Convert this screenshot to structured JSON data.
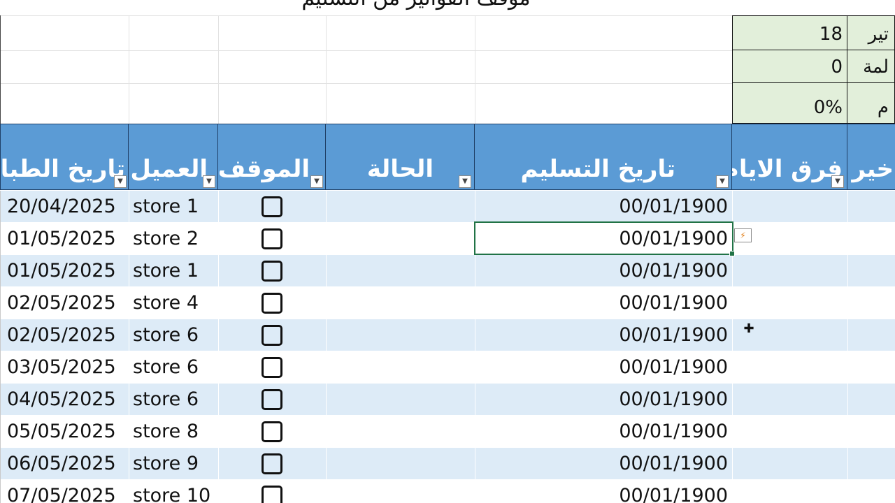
{
  "title": "موقف الفواتير من التسليم",
  "summary": [
    {
      "label": "تير",
      "value": "18"
    },
    {
      "label": "لمة",
      "value": "0"
    },
    {
      "label": "م",
      "value": "0%"
    }
  ],
  "columns": [
    {
      "key": "print_date",
      "label": "تاريخ الطباء"
    },
    {
      "key": "client",
      "label": "العميل"
    },
    {
      "key": "status_flag",
      "label": "الموقف"
    },
    {
      "key": "state",
      "label": "الحالة"
    },
    {
      "key": "delivery_date",
      "label": "تاريخ التسليم"
    },
    {
      "key": "days_diff",
      "label": "فرق الايام"
    },
    {
      "key": "delay",
      "label": "خير"
    }
  ],
  "rows": [
    {
      "print_date": "20/04/2025",
      "client": "store 1",
      "delivery_date": "00/01/1900"
    },
    {
      "print_date": "01/05/2025",
      "client": "store 2",
      "delivery_date": "00/01/1900"
    },
    {
      "print_date": "01/05/2025",
      "client": "store 1",
      "delivery_date": "00/01/1900"
    },
    {
      "print_date": "02/05/2025",
      "client": "store 4",
      "delivery_date": "00/01/1900"
    },
    {
      "print_date": "02/05/2025",
      "client": "store 6",
      "delivery_date": "00/01/1900"
    },
    {
      "print_date": "03/05/2025",
      "client": "store 6",
      "delivery_date": "00/01/1900"
    },
    {
      "print_date": "04/05/2025",
      "client": "store 6",
      "delivery_date": "00/01/1900"
    },
    {
      "print_date": "05/05/2025",
      "client": "store 8",
      "delivery_date": "00/01/1900"
    },
    {
      "print_date": "06/05/2025",
      "client": "store 9",
      "delivery_date": "00/01/1900"
    },
    {
      "print_date": "07/05/2025",
      "client": "store 10",
      "delivery_date": "00/01/1900"
    }
  ],
  "icons": {
    "filter": "dropdown-arrow",
    "flash_fill": "flash-fill-options-icon",
    "cursor": "cross-cursor-icon"
  },
  "colors": {
    "header_bg": "#5b9bd5",
    "band_bg": "#ddebf7",
    "summary_bg": "#e2efda",
    "selection": "#217346"
  }
}
